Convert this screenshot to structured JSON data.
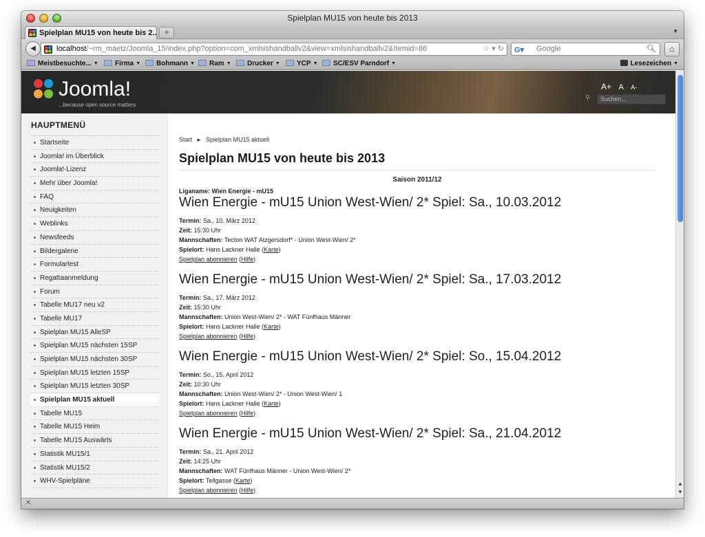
{
  "window": {
    "title": "Spielplan MU15 von heute bis 2013"
  },
  "tab": {
    "label": "Spielplan MU15 von heute bis 2...",
    "new_tab": "+"
  },
  "navbar": {
    "url_host": "localhost",
    "url_path": "/~rm_maetz/Joomla_15/index.php?option=com_xmlsishandballv2&view=xmlsishandballv2&Itemid=86",
    "search_placeholder": "Google"
  },
  "bookmarks": {
    "items": [
      {
        "label": "Meistbesuchte..."
      },
      {
        "label": "Firma"
      },
      {
        "label": "Bohmann"
      },
      {
        "label": "Ram"
      },
      {
        "label": "Drucker"
      },
      {
        "label": "YCP"
      },
      {
        "label": "SC/ESV Parndorf"
      }
    ],
    "reader": "Lesezeichen"
  },
  "header": {
    "logo_text": "Joomla!",
    "logo_tagline": "...because open source matters",
    "font_sizer": [
      "A+",
      "A",
      "A-"
    ],
    "search_placeholder": "Suchen..."
  },
  "sidebar": {
    "title": "HAUPTMENÜ",
    "items": [
      "Startseite",
      "Joomla! im Überblick",
      "Joomla!-Lizenz",
      "Mehr über Joomla!",
      "FAQ",
      "Neuigkeiten",
      "Weblinks",
      "Newsfeeds",
      "Bildergalerie",
      "Formulartest",
      "Regattaanmeldung",
      "Forum",
      "Tabelle MU17 neu v2",
      "Tabelle MU17",
      "Spielplan MU15 AlleSP",
      "Spielplan MU15 nächsten 15SP",
      "Spielplan MU15 nächsten 30SP",
      "Spielplan MU15 letzten 15SP",
      "Spielplan MU15 letzten 30SP",
      "Spielplan MU15 aktuell",
      "Tabelle MU15",
      "Tabelle MU15 Heim",
      "Tabelle MU15 Auswärts",
      "Statistik MU15/1",
      "Statistik MU15/2",
      "WHV-Spielpläne"
    ],
    "active_index": 19
  },
  "main": {
    "breadcrumb": [
      "Start",
      "Spielplan MU15 aktuell"
    ],
    "page_title": "Spielplan MU15 von heute bis 2013",
    "season": "Saison 2011/12",
    "league_label": "Liganame:",
    "league_value": "Wien Energie - mU15",
    "labels": {
      "termin": "Termin:",
      "zeit": "Zeit:",
      "mannschaften": "Mannschaften:",
      "spielort": "Spielort:",
      "karte": "Karte",
      "abo": "Spielplan abonnieren",
      "hilfe": "Hilfe"
    },
    "games": [
      {
        "title": "Wien Energie - mU15 Union West-Wien/ 2* Spiel: Sa., 10.03.2012",
        "termin": "Sa., 10. März 2012",
        "zeit": "15:30 Uhr",
        "mannschaften": "Tecton WAT Atzgersdorf* - Union West-Wien/ 2*",
        "spielort": "Hans Lackner Halle"
      },
      {
        "title": "Wien Energie - mU15 Union West-Wien/ 2* Spiel: Sa., 17.03.2012",
        "termin": "Sa., 17. März 2012",
        "zeit": "15:30 Uhr",
        "mannschaften": "Union West-Wien/ 2* - WAT Fünfhaus Männer",
        "spielort": "Hans Lackner Halle"
      },
      {
        "title": "Wien Energie - mU15 Union West-Wien/ 2* Spiel: So., 15.04.2012",
        "termin": "So., 15. April 2012",
        "zeit": "10:30 Uhr",
        "mannschaften": "Union West-Wien/ 2* - Union West-Wien/ 1",
        "spielort": "Hans Lackner Halle"
      },
      {
        "title": "Wien Energie - mU15 Union West-Wien/ 2* Spiel: Sa., 21.04.2012",
        "termin": "Sa., 21. April 2012",
        "zeit": "14:25 Uhr",
        "mannschaften": "WAT Fünfhaus Männer - Union West-Wien/ 2*",
        "spielort": "Tellgasse"
      }
    ]
  }
}
